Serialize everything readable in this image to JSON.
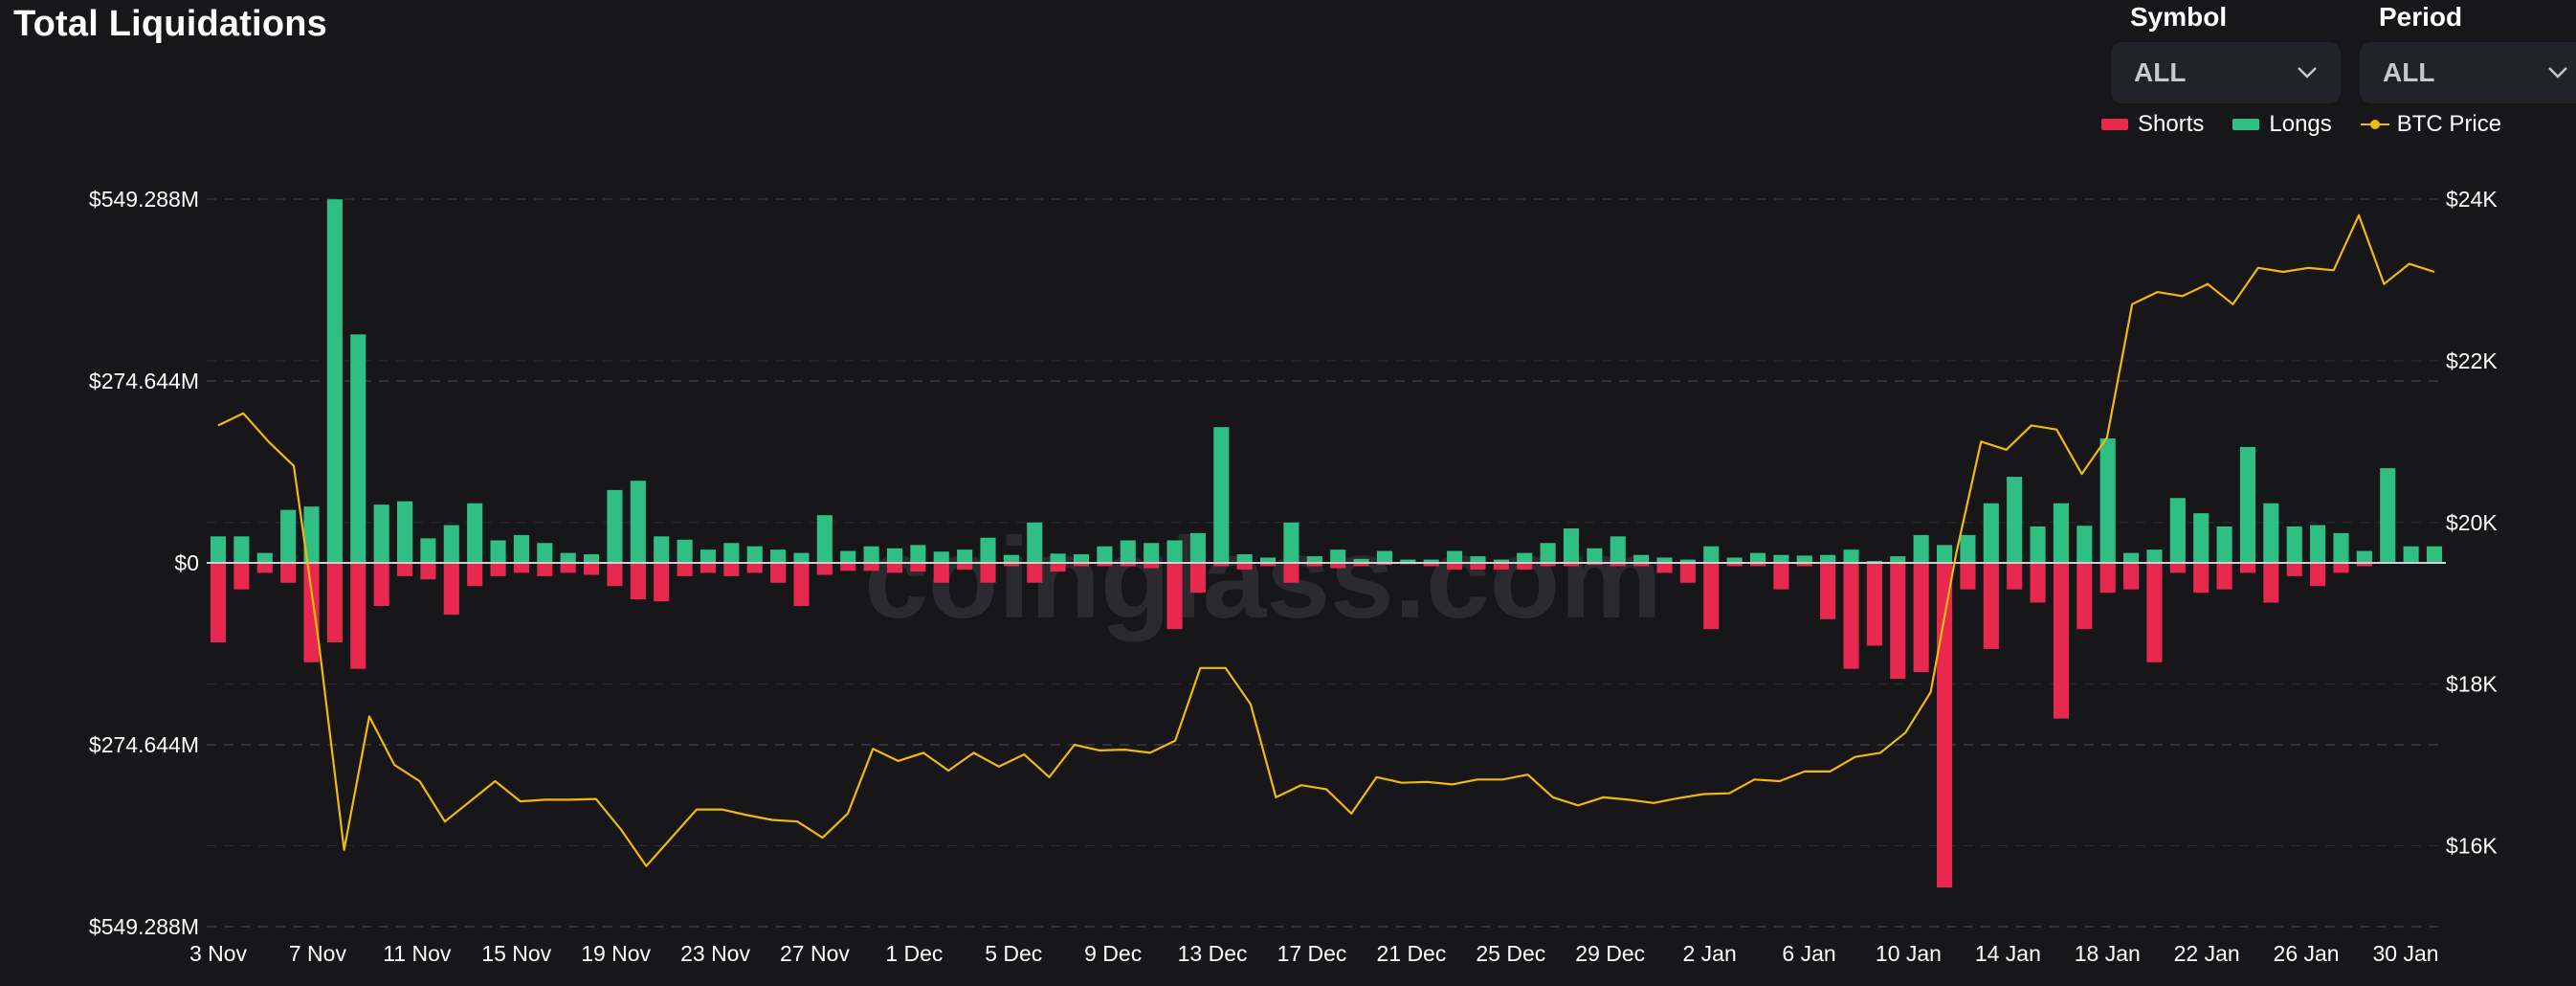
{
  "header": {
    "title": "Total Liquidations",
    "symbol_label": "Symbol",
    "symbol_value": "ALL",
    "period_label": "Period",
    "period_value": "ALL"
  },
  "legend": [
    {
      "name": "Shorts",
      "color": "#e8294f"
    },
    {
      "name": "Longs",
      "color": "#2fbf84"
    },
    {
      "name": "BTC Price",
      "color": "#f0b90b"
    }
  ],
  "watermark": "coinglass.com",
  "chart_data": {
    "type": "bar",
    "x_labels": [
      "3 Nov",
      "7 Nov",
      "11 Nov",
      "15 Nov",
      "19 Nov",
      "23 Nov",
      "27 Nov",
      "1 Dec",
      "5 Dec",
      "9 Dec",
      "13 Dec",
      "17 Dec",
      "21 Dec",
      "25 Dec",
      "29 Dec",
      "2 Jan",
      "6 Jan",
      "10 Jan",
      "14 Jan",
      "18 Jan",
      "22 Jan",
      "26 Jan",
      "30 Jan"
    ],
    "y_left_tick_labels": [
      "$549.288M",
      "$274.644M",
      "$0",
      "$274.644M",
      "$549.288M"
    ],
    "y_left_ticks": [
      549.288,
      274.644,
      0,
      -274.644,
      -549.288
    ],
    "ylim_left": [
      -549.288,
      549.288
    ],
    "y_right_tick_labels": [
      "$24K",
      "$22K",
      "$20K",
      "$18K",
      "$16K"
    ],
    "y_right_ticks": [
      24000,
      22000,
      20000,
      18000,
      16000
    ],
    "ylim_right": [
      15000,
      24000
    ],
    "grid": true,
    "legend_position": "top-right",
    "series": [
      {
        "name": "Longs",
        "type": "bar",
        "values": [
          40,
          40,
          15,
          80,
          85,
          549,
          345,
          88,
          93,
          37,
          57,
          90,
          34,
          42,
          30,
          15,
          13,
          110,
          124,
          40,
          35,
          20,
          30,
          25,
          20,
          15,
          72,
          18,
          25,
          22,
          27,
          17,
          20,
          38,
          12,
          61,
          14,
          13,
          25,
          34,
          30,
          34,
          45,
          205,
          13,
          8,
          61,
          10,
          20,
          6,
          18,
          5,
          5,
          18,
          10,
          5,
          15,
          30,
          52,
          22,
          40,
          12,
          8,
          5,
          25,
          8,
          15,
          12,
          11,
          12,
          20,
          3,
          10,
          42,
          27,
          42,
          90,
          130,
          55,
          90,
          56,
          188,
          15,
          20,
          98,
          75,
          55,
          175,
          90,
          55,
          57,
          45,
          18,
          143,
          25,
          25
        ]
      },
      {
        "name": "Shorts",
        "type": "bar",
        "values": [
          -120,
          -40,
          -15,
          -30,
          -150,
          -120,
          -160,
          -65,
          -20,
          -25,
          -78,
          -35,
          -20,
          -15,
          -20,
          -15,
          -18,
          -35,
          -55,
          -58,
          -20,
          -15,
          -20,
          -15,
          -30,
          -65,
          -18,
          -12,
          -12,
          -15,
          -13,
          -30,
          -10,
          -30,
          -5,
          -30,
          -13,
          -5,
          -5,
          -5,
          -8,
          -100,
          -45,
          -5,
          -10,
          -5,
          -30,
          -5,
          -8,
          -5,
          -3,
          -2,
          -5,
          -10,
          -10,
          -10,
          -10,
          -5,
          -5,
          -3,
          -5,
          -5,
          -15,
          -30,
          -100,
          -5,
          -5,
          -40,
          -5,
          -85,
          -160,
          -125,
          -175,
          -165,
          -490,
          -40,
          -130,
          -40,
          -60,
          -235,
          -100,
          -45,
          -40,
          -150,
          -15,
          -45,
          -40,
          -15,
          -60,
          -20,
          -35,
          -15,
          -5
        ]
      },
      {
        "name": "BTC Price",
        "type": "line",
        "values": [
          21200,
          21350,
          21000,
          20700,
          18500,
          15950,
          17600,
          17000,
          16800,
          16300,
          16550,
          16800,
          16550,
          16570,
          16570,
          16580,
          16200,
          15750,
          16100,
          16450,
          16450,
          16380,
          16320,
          16300,
          16100,
          16400,
          17200,
          17050,
          17150,
          16930,
          17150,
          16980,
          17130,
          16850,
          17250,
          17180,
          17190,
          17150,
          17300,
          18200,
          18200,
          17750,
          16600,
          16750,
          16700,
          16400,
          16850,
          16780,
          16790,
          16760,
          16820,
          16820,
          16880,
          16600,
          16500,
          16600,
          16570,
          16530,
          16590,
          16640,
          16650,
          16820,
          16800,
          16920,
          16920,
          17100,
          17150,
          17400,
          17900,
          19600,
          21000,
          20900,
          21200,
          21150,
          20600,
          21050,
          22700,
          22850,
          22800,
          22950,
          22700,
          23150,
          23100,
          23150,
          23120,
          23800,
          22950,
          23200,
          23100
        ]
      }
    ]
  }
}
